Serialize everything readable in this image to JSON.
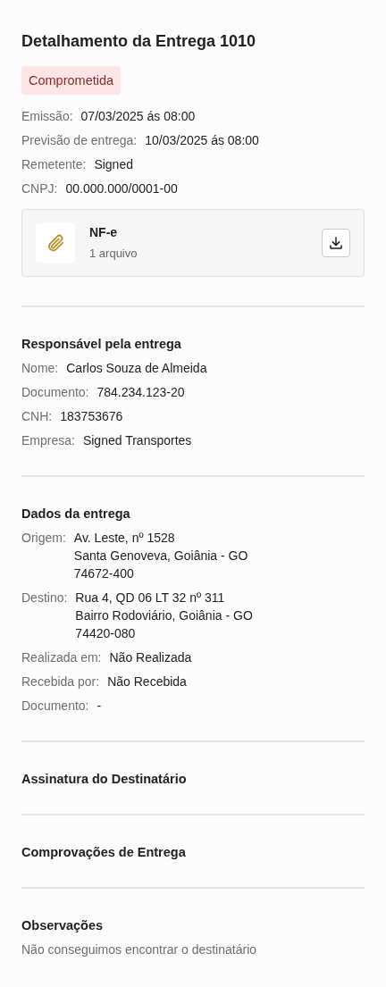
{
  "title": "Detalhamento da Entrega 1010",
  "status": {
    "label": "Comprometida",
    "kind": "danger"
  },
  "summary": [
    {
      "label": "Emissão:",
      "lines": [
        "07/03/2025 ás 08:00"
      ]
    },
    {
      "label": "Previsão de entrega:",
      "lines": [
        "10/03/2025 ás 08:00"
      ]
    },
    {
      "label": "Remetente:",
      "lines": [
        "Signed"
      ]
    },
    {
      "label": "CNPJ:",
      "lines": [
        "00.000.000/0001-00"
      ]
    }
  ],
  "attachment": {
    "name": "NF-e",
    "count": "1 arquivo"
  },
  "sections": [
    {
      "title": "Responsável pela entrega",
      "fields": [
        {
          "label": "Nome:",
          "lines": [
            "Carlos Souza de Almeida"
          ]
        },
        {
          "label": "Documento:",
          "lines": [
            "784.234.123-20"
          ]
        },
        {
          "label": "CNH:",
          "lines": [
            "183753676"
          ]
        },
        {
          "label": "Empresa:",
          "lines": [
            "Signed Transportes"
          ]
        }
      ]
    },
    {
      "title": "Dados da entrega",
      "fields": [
        {
          "label": "Origem:",
          "lines": [
            "Av. Leste, nº 1528",
            "Santa Genoveva, Goiânia - GO",
            "74672-400"
          ]
        },
        {
          "label": "Destino:",
          "lines": [
            "Rua 4, QD 06 LT 32 nº 311",
            "Bairro Rodoviário, Goiânia - GO",
            "74420-080"
          ]
        },
        {
          "label": "Realizada em:",
          "lines": [
            "Não Realizada"
          ]
        },
        {
          "label": "Recebida por:",
          "lines": [
            "Não Recebida"
          ]
        },
        {
          "label": "Documento:",
          "lines": [
            "-"
          ]
        }
      ]
    },
    {
      "title": "Assinatura do Destinatário"
    },
    {
      "title": "Comprovações de Entrega"
    },
    {
      "title": "Observações",
      "text": "Não conseguimos encontrar o destinatário"
    }
  ]
}
